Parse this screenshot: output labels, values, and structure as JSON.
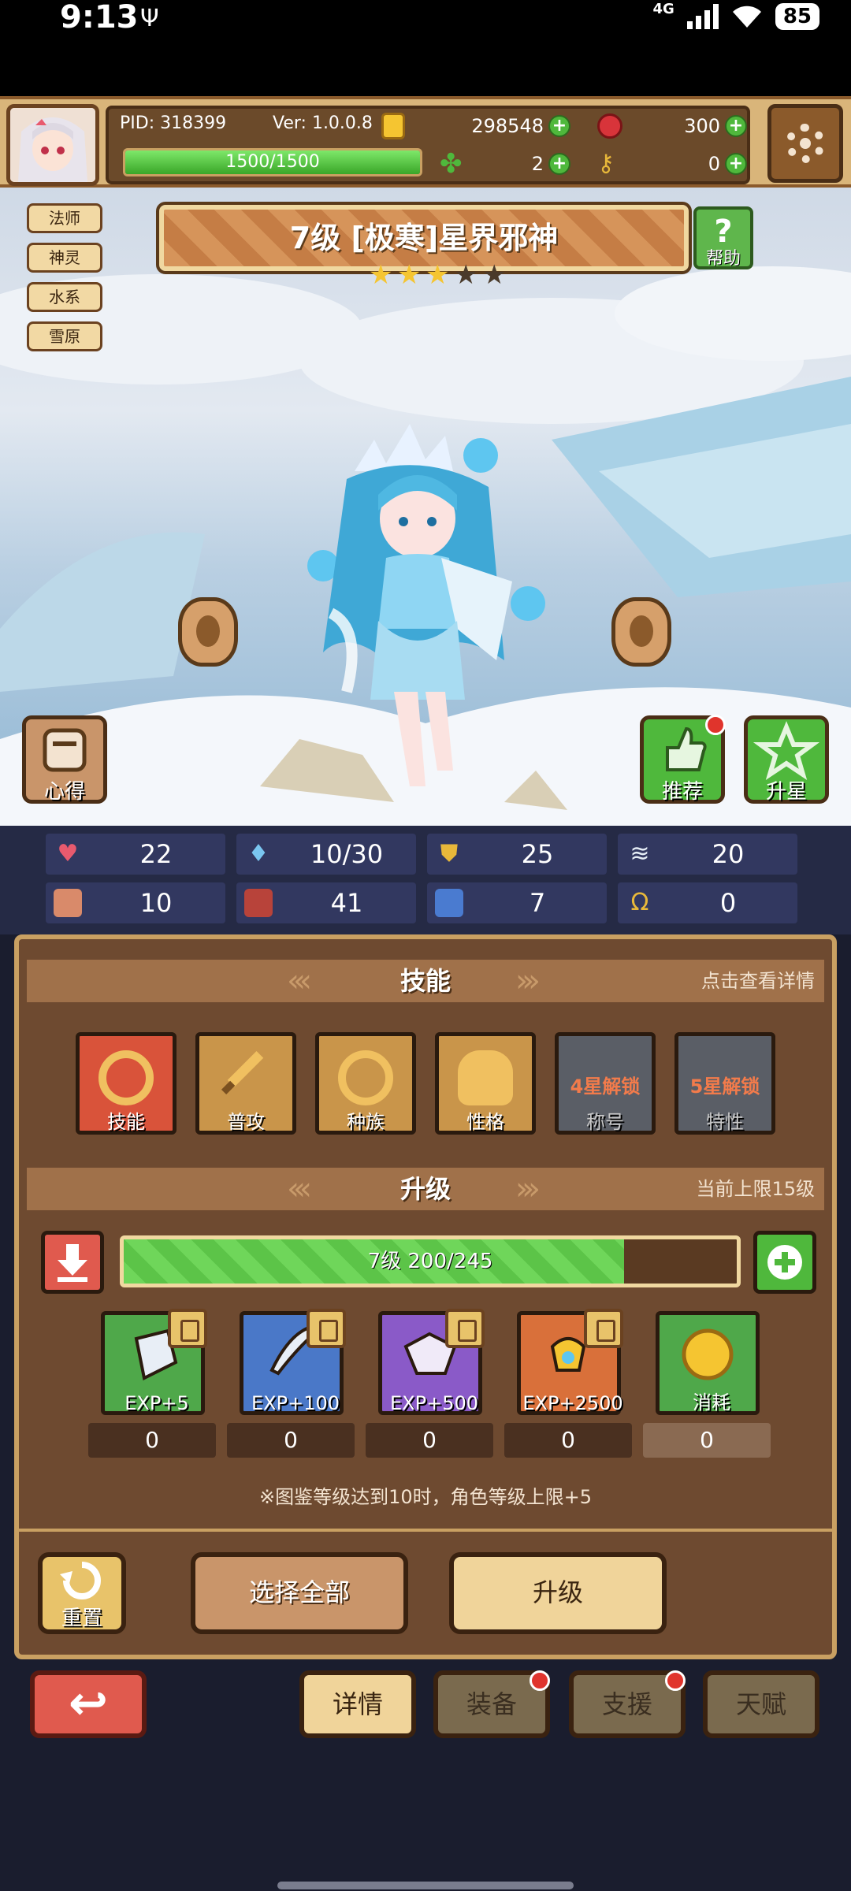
{
  "status_bar": {
    "time": "9:13",
    "network": "4G",
    "battery": "85"
  },
  "topbar": {
    "pid": "PID: 318399",
    "version": "Ver: 1.0.0.8",
    "hp": "1500/1500",
    "hp_fraction": 1.0,
    "gold": "298548",
    "gems": "300",
    "clover": "2",
    "key": "0"
  },
  "scene": {
    "tags": [
      "法师",
      "神灵",
      "水系",
      "雪原"
    ],
    "title": "7级  [极寒]星界邪神",
    "stars_filled": 3,
    "stars_total": 5,
    "help_label": "帮助",
    "xinde_label": "心得",
    "recommend_label": "推荐",
    "upstar_label": "升星"
  },
  "stats": {
    "hp": "22",
    "mana": "10/30",
    "shield": "25",
    "speed": "20",
    "attack": "10",
    "book": "41",
    "boot": "7",
    "luck": "0"
  },
  "skills_section": {
    "title": "技能",
    "right": "点击查看详情",
    "items": [
      {
        "label": "技能"
      },
      {
        "label": "普攻"
      },
      {
        "label": "种族"
      },
      {
        "label": "性格"
      },
      {
        "label": "称号",
        "lock": "4星解锁"
      },
      {
        "label": "特性",
        "lock": "5星解锁"
      }
    ]
  },
  "upgrade_section": {
    "title": "升级",
    "right": "当前上限15级",
    "level_text": "7级 200/245",
    "level_fraction": 0.816,
    "exp_items": [
      {
        "label": "EXP+5",
        "count": "0"
      },
      {
        "label": "EXP+100",
        "count": "0"
      },
      {
        "label": "EXP+500",
        "count": "0"
      },
      {
        "label": "EXP+2500",
        "count": "0"
      },
      {
        "label": "消耗",
        "count": "0"
      }
    ],
    "note": "※图鉴等级达到10时，角色等级上限+5",
    "reset_label": "重置",
    "select_all_label": "选择全部",
    "upgrade_label": "升级"
  },
  "bottom_tabs": {
    "details": "详情",
    "equip": "装备",
    "support": "支援",
    "talent": "天赋"
  },
  "colors": {
    "panel_bg": "#6e4a30",
    "panel_border": "#c9a062",
    "accent_green": "#5fb64c",
    "accent_red": "#e05a4e",
    "star_gold": "#f5c531"
  }
}
